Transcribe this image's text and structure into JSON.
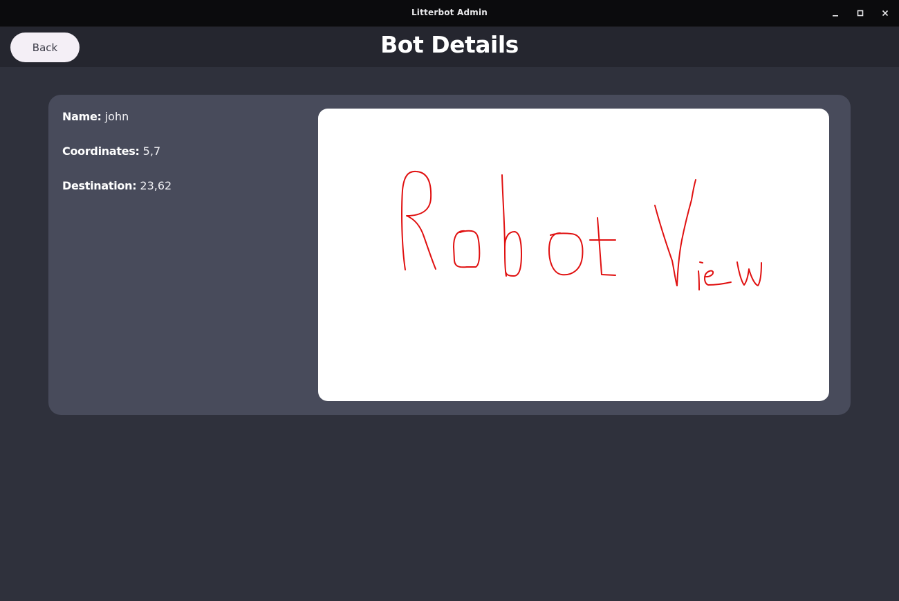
{
  "window": {
    "title": "Litterbot Admin",
    "controls": [
      "minimize-icon",
      "maximize-icon",
      "close-icon"
    ]
  },
  "header": {
    "back_label": "Back",
    "page_title": "Bot Details"
  },
  "details": {
    "name_label": "Name:",
    "name_value": "john",
    "coordinates_label": "Coordinates:",
    "coordinates_value": "5,7",
    "destination_label": "Destination:",
    "destination_value": "23,62"
  },
  "robot_view": {
    "handwritten_text": "Robot View",
    "stroke_color": "#e01010"
  },
  "colors": {
    "background": "#2f313c",
    "header": "#25262f",
    "card": "#484b5b",
    "button": "#f4eff6"
  }
}
